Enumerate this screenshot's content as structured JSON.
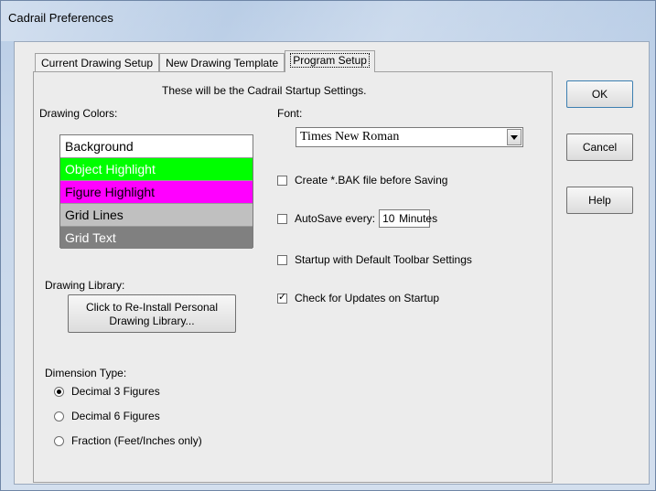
{
  "window": {
    "title": "Cadrail Preferences"
  },
  "tabs": [
    {
      "label": "Current Drawing Setup"
    },
    {
      "label": "New Drawing Template"
    },
    {
      "label": "Program Setup"
    }
  ],
  "header": "These will be the Cadrail Startup Settings.",
  "drawing_colors": {
    "label": "Drawing Colors:",
    "items": [
      {
        "label": "Background",
        "bg": "#ffffff",
        "fg": "#000000"
      },
      {
        "label": "Object Highlight",
        "bg": "#00ff00",
        "fg": "#ffffff"
      },
      {
        "label": "Figure Highlight",
        "bg": "#ff00ff",
        "fg": "#000000"
      },
      {
        "label": "Grid Lines",
        "bg": "#c0c0c0",
        "fg": "#000000"
      },
      {
        "label": "Grid Text",
        "bg": "#808080",
        "fg": "#ffffff"
      }
    ]
  },
  "font": {
    "label": "Font:",
    "value": "Times New Roman"
  },
  "options": {
    "create_bak": {
      "label": "Create *.BAK file before Saving",
      "checked": false
    },
    "autosave": {
      "label": "AutoSave every:",
      "value": "10",
      "unit": "Minutes",
      "checked": false
    },
    "startup_toolbar": {
      "label": "Startup with Default Toolbar Settings",
      "checked": false
    },
    "check_updates": {
      "label": "Check for Updates on Startup",
      "checked": true
    }
  },
  "drawing_library": {
    "label": "Drawing Library:",
    "button_line1": "Click to Re-Install Personal",
    "button_line2": "Drawing Library..."
  },
  "dimension_type": {
    "label": "Dimension Type:",
    "options": [
      {
        "label": "Decimal 3 Figures",
        "selected": true
      },
      {
        "label": "Decimal 6 Figures",
        "selected": false
      },
      {
        "label": "Fraction (Feet/Inches only)",
        "selected": false
      }
    ]
  },
  "buttons": {
    "ok": "OK",
    "cancel": "Cancel",
    "help": "Help"
  }
}
